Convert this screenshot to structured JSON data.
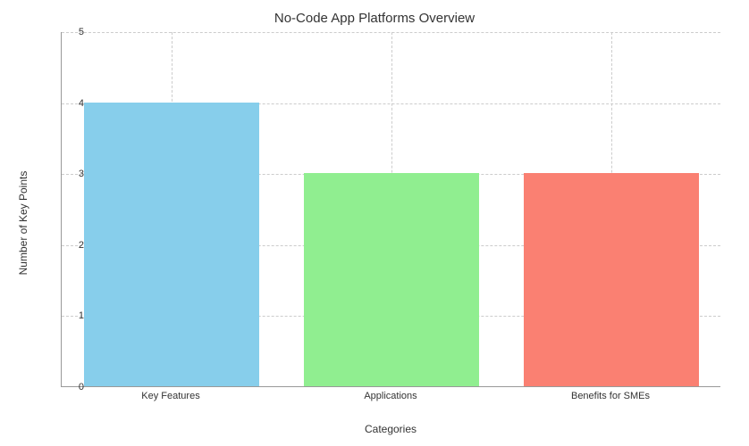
{
  "chart_data": {
    "type": "bar",
    "title": "No-Code App Platforms Overview",
    "xlabel": "Categories",
    "ylabel": "Number of Key Points",
    "ylim": [
      0,
      5
    ],
    "categories": [
      "Key Features",
      "Applications",
      "Benefits for SMEs"
    ],
    "values": [
      4,
      3,
      3
    ],
    "colors": [
      "#87ceeb",
      "#90ee90",
      "#fa8072"
    ],
    "yticks": [
      0,
      1,
      2,
      3,
      4,
      5
    ]
  }
}
